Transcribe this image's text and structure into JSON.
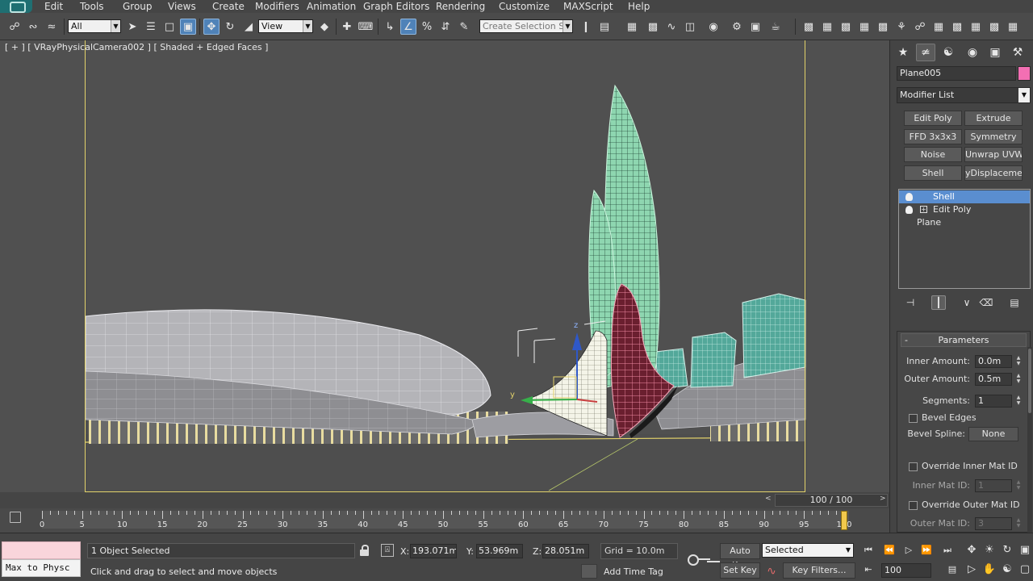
{
  "menu": {
    "items": [
      "Edit",
      "Tools",
      "Group",
      "Views",
      "Create",
      "Modifiers",
      "Animation",
      "Graph Editors",
      "Rendering",
      "Customize",
      "MAXScript",
      "Help"
    ]
  },
  "toolbar": {
    "selection_filter": "All",
    "ref_coord_system": "View",
    "named_selection_placeholder": "Create Selection Se"
  },
  "viewport": {
    "label": "[ + ] [ VRayPhysicalCamera002 ] [ Shaded + Edged Faces ]",
    "gizmo_axis_y": "y",
    "gizmo_axis_z": "z"
  },
  "command_panel": {
    "object_name": "Plane005",
    "object_color": "#f36fb3",
    "modifier_list": "Modifier List",
    "modifier_buttons": [
      "Edit Poly",
      "Extrude",
      "FFD 3x3x3",
      "Symmetry",
      "Noise",
      "Unwrap UVW",
      "Shell",
      "yDisplacement"
    ],
    "stack": [
      {
        "label": "Shell",
        "selected": true
      },
      {
        "label": "Edit Poly",
        "selected": false
      },
      {
        "label": "Plane",
        "selected": false
      }
    ],
    "parameters": {
      "title": "Parameters",
      "collapse_symbol": "-",
      "inner_amount_label": "Inner Amount:",
      "inner_amount": "0.0m",
      "outer_amount_label": "Outer Amount:",
      "outer_amount": "0.5m",
      "segments_label": "Segments:",
      "segments": "1",
      "bevel_edges": "Bevel Edges",
      "bevel_spline_label": "Bevel Spline:",
      "bevel_spline_value": "None",
      "override_inner": "Override Inner Mat ID",
      "inner_mat_id_label": "Inner Mat ID:",
      "inner_mat_id": "1",
      "override_outer": "Override Outer Mat ID",
      "outer_mat_id_label": "Outer Mat ID:",
      "outer_mat_id": "3"
    }
  },
  "timeline": {
    "frame_display": "100 / 100",
    "prev_symbol": "<",
    "next_symbol": ">",
    "ticks": [
      0,
      5,
      10,
      15,
      20,
      25,
      30,
      35,
      40,
      45,
      50,
      55,
      60,
      65,
      70,
      75,
      80,
      85,
      90,
      95,
      100
    ],
    "current_frame": 100,
    "max_frame": 100
  },
  "status": {
    "maxscript_text": "Max to Physc",
    "selection_info": "1 Object Selected",
    "prompt": "Click and drag to select and move objects",
    "x_label": "X:",
    "x_value": "193.071m",
    "y_label": "Y:",
    "y_value": "53.969m",
    "z_label": "Z:",
    "z_value": "28.051m",
    "grid": "Grid = 10.0m",
    "add_time_tag": "Add Time Tag",
    "auto_key": "Auto Key",
    "set_key": "Set Key",
    "selected_dd": "Selected",
    "key_filters": "Key Filters...",
    "frame_field": "100"
  }
}
